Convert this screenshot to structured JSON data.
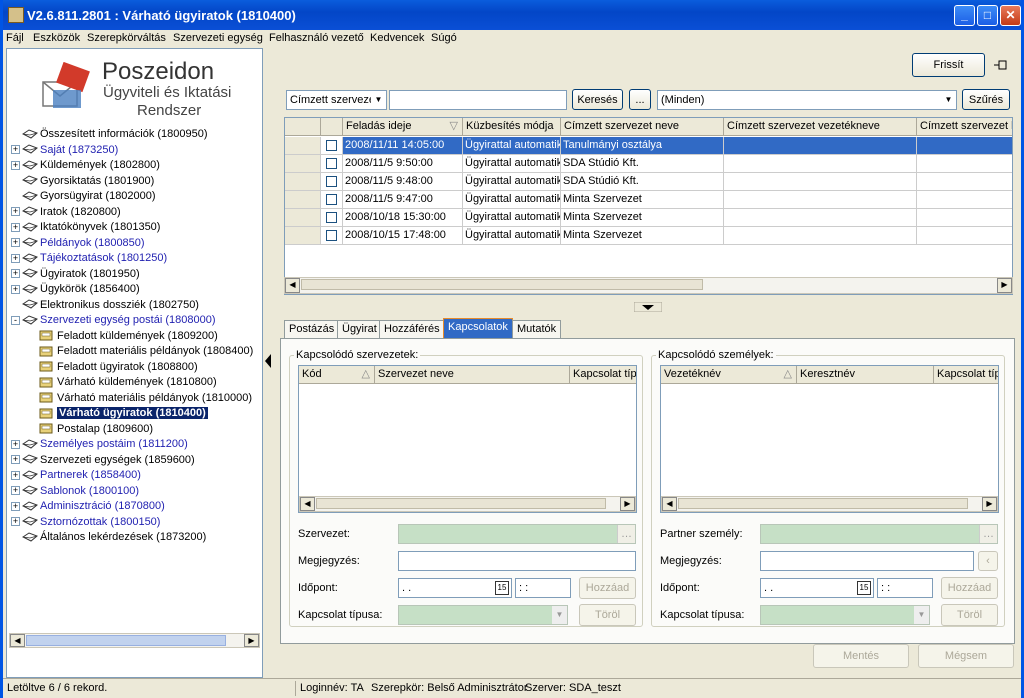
{
  "window": {
    "title": "V2.6.811.2801 : Várható ügyiratok (1810400)"
  },
  "menu": [
    "Fájl",
    "Eszközök",
    "Szerepkörváltás",
    "Szervezeti egység",
    "Felhasználó vezető",
    "Kedvencek",
    "Súgó"
  ],
  "logo": {
    "line1": "Poszeidon",
    "line2": "Ügyviteli és Iktatási",
    "line3": "Rendszer"
  },
  "tree": [
    {
      "label": "Összesített információk (1800950)",
      "blue": false,
      "expander": ""
    },
    {
      "label": "Saját (1873250)",
      "blue": true,
      "expander": "+"
    },
    {
      "label": "Küldemények (1802800)",
      "blue": false,
      "expander": "+"
    },
    {
      "label": "Gyorsiktatás (1801900)",
      "blue": false,
      "expander": ""
    },
    {
      "label": "Gyorsügyirat (1802000)",
      "blue": false,
      "expander": ""
    },
    {
      "label": "Iratok (1820800)",
      "blue": false,
      "expander": "+"
    },
    {
      "label": "Iktatókönyvek (1801350)",
      "blue": false,
      "expander": "+"
    },
    {
      "label": "Példányok (1800850)",
      "blue": true,
      "expander": "+"
    },
    {
      "label": "Tájékoztatások (1801250)",
      "blue": true,
      "expander": "+"
    },
    {
      "label": "Ügyiratok (1801950)",
      "blue": false,
      "expander": "+"
    },
    {
      "label": "Ügykörök (1856400)",
      "blue": false,
      "expander": "+"
    },
    {
      "label": "Elektronikus dossziék (1802750)",
      "blue": false,
      "expander": ""
    },
    {
      "label": "Szervezeti egység postái (1808000)",
      "blue": true,
      "expander": "-"
    },
    {
      "label": "Feladott küldemények (1809200)",
      "child": true
    },
    {
      "label": "Feladott materiális példányok (1808400)",
      "child": true
    },
    {
      "label": "Feladott ügyiratok (1808800)",
      "child": true
    },
    {
      "label": "Várható küldemények (1810800)",
      "child": true
    },
    {
      "label": "Várható materiális példányok (1810000)",
      "child": true
    },
    {
      "label": "Várható ügyiratok (1810400)",
      "child": true,
      "selected": true
    },
    {
      "label": "Postalap (1809600)",
      "child": true
    },
    {
      "label": "Személyes postáim (1811200)",
      "blue": true,
      "expander": "+"
    },
    {
      "label": "Szervezeti egységek (1859600)",
      "blue": false,
      "expander": "+"
    },
    {
      "label": "Partnerek (1858400)",
      "blue": true,
      "expander": "+"
    },
    {
      "label": "Sablonok (1800100)",
      "blue": true,
      "expander": "+"
    },
    {
      "label": "Adminisztráció (1870800)",
      "blue": true,
      "expander": "+"
    },
    {
      "label": "Sztornózottak (1800150)",
      "blue": true,
      "expander": "+"
    },
    {
      "label": "Általános lekérdezések (1873200)",
      "blue": false,
      "expander": ""
    }
  ],
  "toolbar": {
    "refresh": "Frissít",
    "pin_icon": "pin-icon"
  },
  "filter": {
    "field_value": "Címzett szervezete",
    "search_text": "",
    "search_btn": "Keresés",
    "ellipsis": "...",
    "filter_value": "(Minden)",
    "filter_btn": "Szűrés"
  },
  "grid": {
    "columns": [
      "Feladás ideje",
      "Küzbesítés módja",
      "Címzett szervezet neve",
      "Címzett szervezet vezetékneve",
      "Címzett szervezet ke"
    ],
    "rows": [
      [
        "2008/11/11 14:05:00",
        "Ügyirattal automatiku",
        "Tanulmányi osztálya"
      ],
      [
        "2008/11/5 9:50:00",
        "Ügyirattal automatiku",
        "SDA Stúdió Kft."
      ],
      [
        "2008/11/5 9:48:00",
        "Ügyirattal automatiku",
        "SDA Stúdió Kft."
      ],
      [
        "2008/11/5 9:47:00",
        "Ügyirattal automatiku",
        "Minta Szervezet"
      ],
      [
        "2008/10/18 15:30:00",
        "Ügyirattal automatiku",
        "Minta Szervezet"
      ],
      [
        "2008/10/15 17:48:00",
        "Ügyirattal automatiku",
        "Minta Szervezet"
      ]
    ]
  },
  "tabs": [
    "Postázás",
    "Ügyirat",
    "Hozzáférés",
    "Kapcsolatok",
    "Mutatók"
  ],
  "active_tab": "Kapcsolatok",
  "left_group": {
    "title": "Kapcsolódó szervezetek:",
    "columns": [
      "Kód",
      "Szervezet neve",
      "Kapcsolat típu"
    ],
    "field1": "Szervezet:",
    "field2": "Megjegyzés:",
    "field3": "Időpont:",
    "field4": "Kapcsolat típusa:",
    "date": " .  .",
    "time": " :  :",
    "add": "Hozzáad",
    "del": "Töröl"
  },
  "right_group": {
    "title": "Kapcsolódó személyek:",
    "columns": [
      "Vezetéknév",
      "Keresztnév",
      "Kapcsolat típu"
    ],
    "field1": "Partner személy:",
    "field2": "Megjegyzés:",
    "field3": "Időpont:",
    "field4": "Kapcsolat típusa:",
    "date": " .  .",
    "time": " :  :",
    "add": "Hozzáad",
    "del": "Töröl"
  },
  "footer": {
    "save": "Mentés",
    "cancel": "Mégsem"
  },
  "status": {
    "records": "Letöltve 6 / 6 rekord.",
    "login": "Loginnév: TA",
    "role": "Szerepkör: Belső Adminisztrátor",
    "server": "Szerver: SDA_teszt"
  }
}
